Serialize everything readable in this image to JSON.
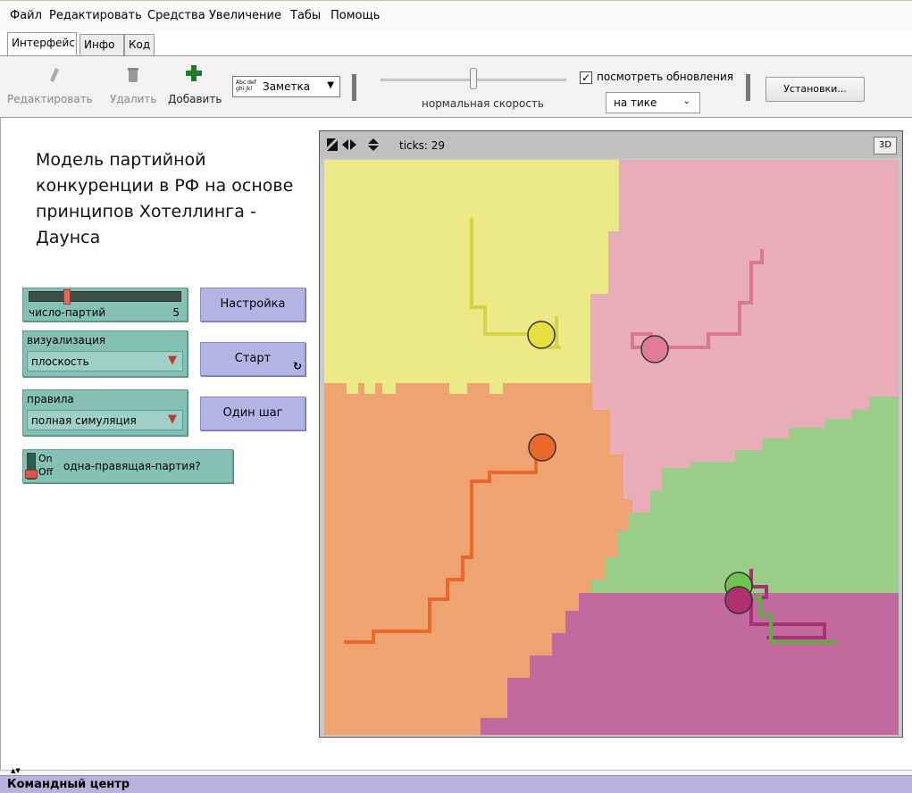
{
  "menu": [
    "Файл",
    "Редактировать",
    "Средства",
    "Увеличение",
    "Табы",
    "Помощь"
  ],
  "tabs": [
    "Интерфейс",
    "Инфо",
    "Код"
  ],
  "toolbar": {
    "edit": "Редактировать",
    "delete": "Удалить",
    "add": "Добавить",
    "note_preview": "Abc def ghi jkl",
    "note_type": "Заметка",
    "speed_label": "нормальная скорость",
    "speed_value": 0.5,
    "updates_label": "посмотреть обновления",
    "updates_checked": true,
    "update_mode": "на тике",
    "settings": "Установки..."
  },
  "model_title": "Модель партийной конкуренции в РФ на основе принципов Хотеллинга - Даунса",
  "widgets": {
    "slider_label": "число-партий",
    "slider_value": "5",
    "slider_fraction": 0.25,
    "viz_label": "визуализация",
    "viz_value": "плоскость",
    "rules_label": "правила",
    "rules_value": "полная симуляция",
    "switch_on": "On",
    "switch_off": "Off",
    "switch_label": "одна-правящая-партия?",
    "setup": "Настройка",
    "go": "Старт",
    "step": "Один шаг"
  },
  "world": {
    "ticks_label": "ticks: 29",
    "three_d": "3D",
    "colors": {
      "yellow": "#ecea86",
      "pink": "#e9adb9",
      "orange": "#eea370",
      "green": "#9acd88",
      "magenta": "#c2699d"
    }
  },
  "command_center": "Командный центр"
}
